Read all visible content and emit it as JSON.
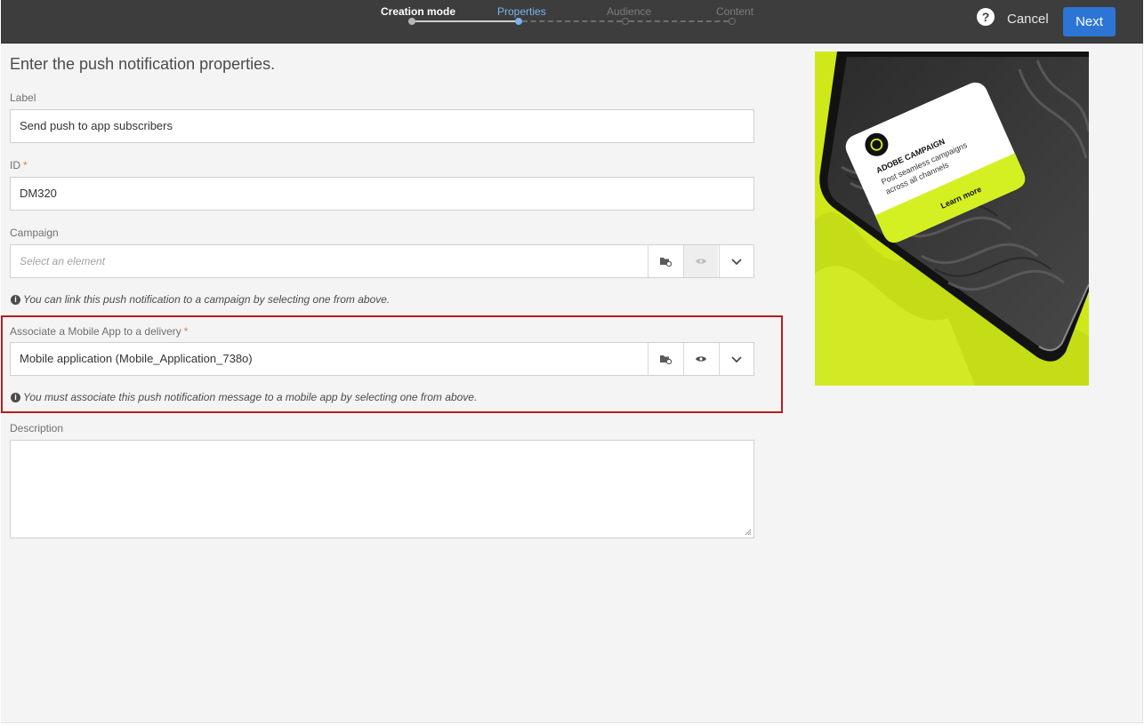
{
  "wizard": {
    "steps": [
      {
        "label": "Creation mode",
        "state": "done"
      },
      {
        "label": "Properties",
        "state": "current"
      },
      {
        "label": "Audience",
        "state": "todo"
      },
      {
        "label": "Content",
        "state": "todo"
      }
    ]
  },
  "toolbar": {
    "help_label": "?",
    "cancel_label": "Cancel",
    "next_label": "Next"
  },
  "form": {
    "heading": "Enter the push notification properties.",
    "label": {
      "title": "Label",
      "value": "Send push to app subscribers"
    },
    "id": {
      "title": "ID",
      "required_mark": "*",
      "value": "DM320"
    },
    "campaign": {
      "title": "Campaign",
      "placeholder": "Select an element",
      "hint": "You can link this push notification to a campaign by selecting one from above."
    },
    "mobile_app": {
      "title": "Associate a Mobile App to a delivery",
      "required_mark": "*",
      "value": "Mobile application (Mobile_Application_738o)",
      "hint": "You must associate this push notification message to a mobile app by selecting one from above."
    },
    "description": {
      "title": "Description",
      "value": ""
    }
  },
  "promo": {
    "brand": "ADOBE CAMPAIGN",
    "line1": "Post seamless campaigns",
    "line2": "across all channels",
    "cta": "Learn more",
    "accent_color": "#d4f022"
  },
  "colors": {
    "topbar": "#3d3d3d",
    "primary_button": "#2d75d5",
    "current_step": "#7bb2ef",
    "highlight_border": "#b91c1c",
    "required": "#e6794b"
  },
  "icons": {
    "help": "question-circle-icon",
    "folder": "folder-browse-icon",
    "preview": "eye-icon",
    "dropdown": "chevron-down-icon",
    "info": "info-circle-icon"
  }
}
